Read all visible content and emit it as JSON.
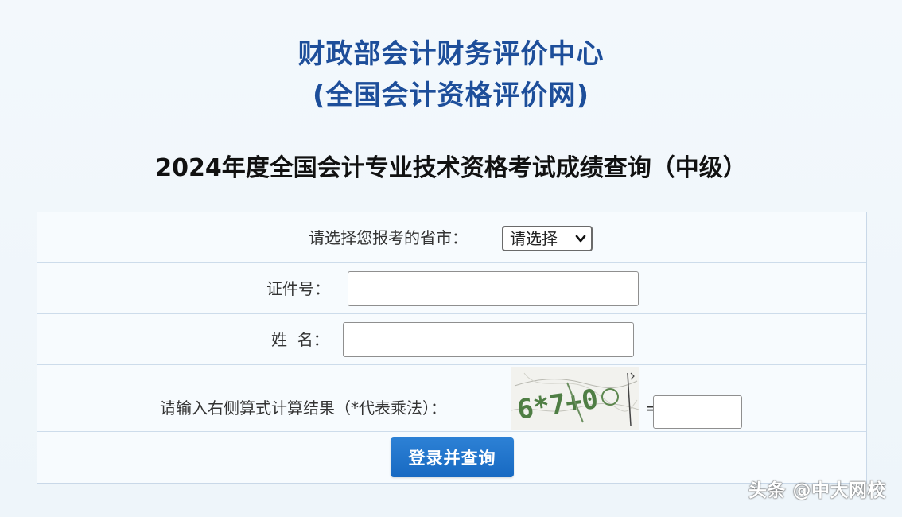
{
  "header": {
    "org_title": "财政部会计财务评价中心",
    "org_subtitle": "(全国会计资格评价网)",
    "exam_title": "2024年度全国会计专业技术资格考试成绩查询（中级）"
  },
  "form": {
    "province_label": "请选择您报考的省市：",
    "province_select_value": "请选择",
    "id_label": "证件号：",
    "id_value": "",
    "name_label": "姓  名：",
    "name_value": "",
    "captcha_label": "请输入右侧算式计算结果（*代表乘法）：",
    "captcha_image_text": "6*7+0",
    "equals": "=",
    "captcha_answer_value": "",
    "submit_label": "登录并查询"
  },
  "watermark": {
    "text": "头条 @中大网校"
  },
  "colors": {
    "title_blue": "#1d4e9a",
    "button_blue": "#1f73cb",
    "background": "#f1f7fb"
  }
}
